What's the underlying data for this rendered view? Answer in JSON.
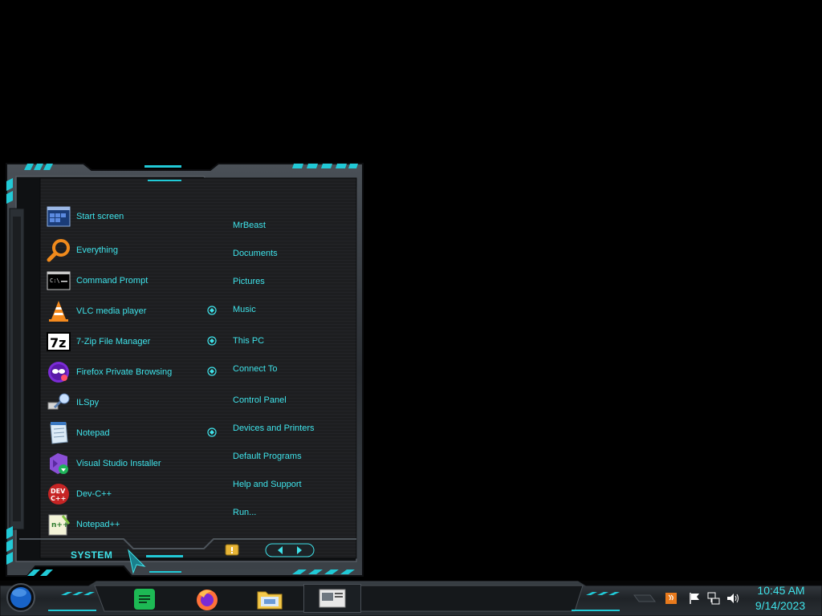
{
  "start_menu": {
    "left_items": [
      {
        "label": "Start screen",
        "icon": "start-screen-icon"
      },
      {
        "label": "Everything",
        "icon": "everything-search-icon"
      },
      {
        "label": "Command Prompt",
        "icon": "command-prompt-icon"
      },
      {
        "label": "VLC media player",
        "icon": "vlc-cone-icon"
      },
      {
        "label": "7-Zip File Manager",
        "icon": "7zip-icon"
      },
      {
        "label": "Firefox Private Browsing",
        "icon": "firefox-private-icon"
      },
      {
        "label": "ILSpy",
        "icon": "ilspy-icon"
      },
      {
        "label": "Notepad",
        "icon": "notepad-icon"
      },
      {
        "label": "Visual Studio Installer",
        "icon": "visual-studio-installer-icon"
      },
      {
        "label": "Dev-C++",
        "icon": "dev-cpp-icon"
      },
      {
        "label": "Notepad++",
        "icon": "notepad-plus-plus-icon"
      }
    ],
    "right_items": [
      "MrBeast",
      "Documents",
      "Pictures",
      "Music",
      "This PC",
      "Connect To",
      "Control Panel",
      "Devices and Printers",
      "Default Programs",
      "Help and Support",
      "Run..."
    ],
    "system_label": "SYSTEM"
  },
  "taskbar": {
    "apps": [
      "sticky-notes-icon",
      "firefox-icon",
      "file-explorer-icon",
      "active-window-icon"
    ],
    "clock_time": "10:45 AM",
    "clock_date": "9/14/2023"
  },
  "colors": {
    "accent": "#3fe3ea",
    "frame_dark": "#1a1d21",
    "frame_mid": "#3a3f45",
    "panel_bg": "#1c1d1f"
  }
}
